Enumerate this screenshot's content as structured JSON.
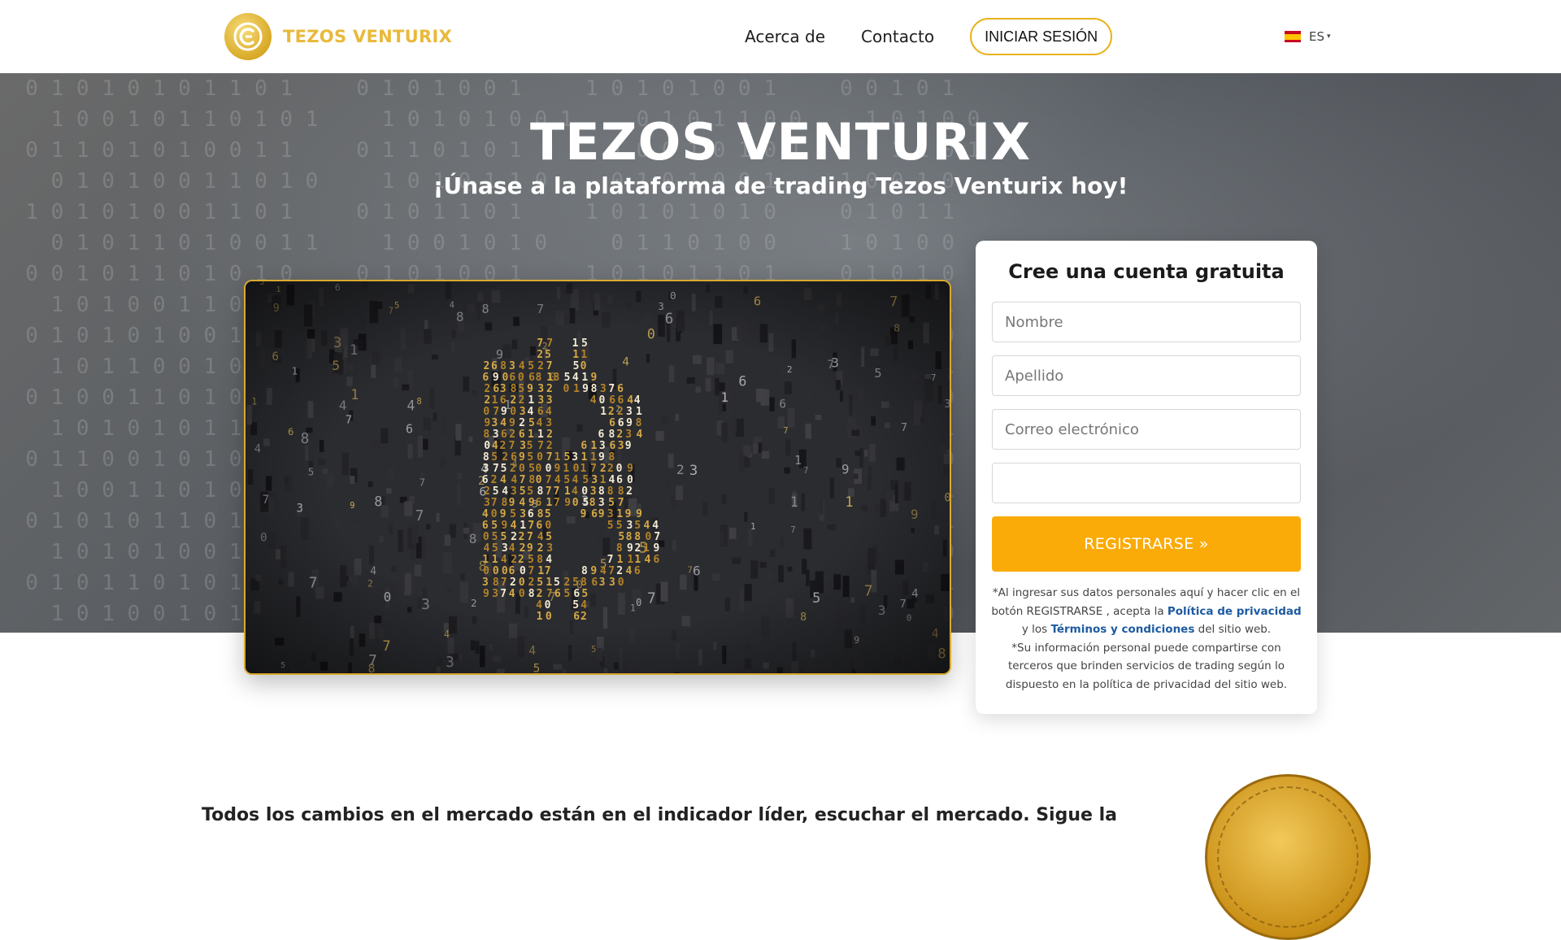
{
  "header": {
    "brand": "TEZOS VENTURIX",
    "nav": [
      {
        "label": "Acerca de"
      },
      {
        "label": "Contacto"
      }
    ],
    "login_label": "INICIAR SESIÓN",
    "language": "ES",
    "icons": {
      "logo": "coin-logo-icon",
      "flag": "spain-flag-icon",
      "caret": "caret-down-icon"
    },
    "colors": {
      "brand": "#e8b93a",
      "login_border": "#e8b21b"
    }
  },
  "hero": {
    "title": "TEZOS VENTURIX",
    "subtitle": "¡Únase a la plataforma de trading Tezos Venturix hoy!"
  },
  "form": {
    "title": "Cree una cuenta gratuita",
    "fields": [
      {
        "placeholder": "Nombre",
        "value": ""
      },
      {
        "placeholder": "Apellido",
        "value": ""
      },
      {
        "placeholder": "Correo electrónico",
        "value": ""
      },
      {
        "placeholder": "",
        "value": ""
      }
    ],
    "submit_label": "REGISTRARSE  »",
    "submit_color": "#fbab07",
    "disclaimer": {
      "part1": "*Al ingresar sus datos personales aquí y hacer clic en el botón REGISTRARSE , acepta la ",
      "privacy_link": "Política de privacidad",
      "part2": " y los ",
      "terms_link": "Términos y condiciones",
      "part3": " del sitio web.",
      "part4": "*Su información personal puede compartirse con terceros que brinden servicios de trading según lo dispuesto en la política de privacidad del sitio web."
    }
  },
  "bottom": {
    "text": "Todos los cambios en el mercado están en el indicador líder, escuchar el mercado. Sigue la"
  }
}
